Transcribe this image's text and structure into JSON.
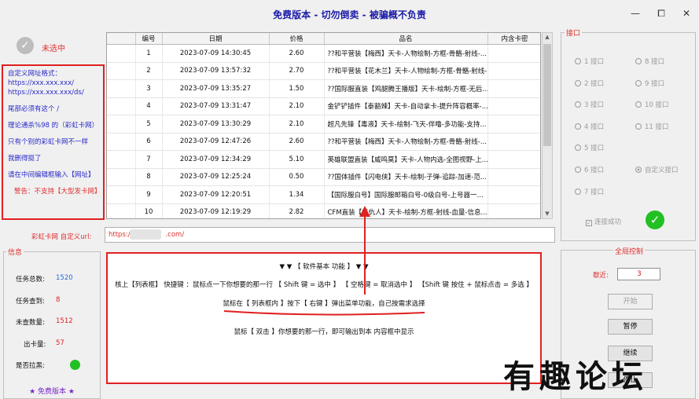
{
  "window": {
    "title": "免费版本 - 切勿倒卖 - 被骗概不负责",
    "min": "—",
    "max": "⧠",
    "close": "✕"
  },
  "status": {
    "unselected": "未选中"
  },
  "note": {
    "lines": [
      "自定义网址格式：",
      "https://xxx.xxx.xxx/",
      "https://xxx.xxx.xxx/ds/",
      "尾部必须有这个 /",
      "理论通杀%98 的（彩虹卡网）",
      "只有个别的彩虹卡网不一样",
      "我删得挺了",
      "请在中间编辑框输入【网址】",
      "警告：不支持【大型发卡网】"
    ]
  },
  "table": {
    "headers": [
      "",
      "编号",
      "日期",
      "价格",
      "品名",
      "内含卡密"
    ],
    "rows": [
      {
        "no": "1",
        "date": "2023-07-09 14:30:45",
        "price": "2.60",
        "name": "??和平营装【梅西】天卡-人物绘制-方框-骨骼-射线-...",
        "card": ""
      },
      {
        "no": "2",
        "date": "2023-07-09 13:57:32",
        "price": "2.70",
        "name": "??和平营装【花木兰】天卡-人物绘制-方框-骨骼-射线-...",
        "card": ""
      },
      {
        "no": "3",
        "date": "2023-07-09 13:35:27",
        "price": "1.50",
        "name": "??国际服直装【鸡腿腾王播版】天卡-绘制-方框-无后...",
        "card": ""
      },
      {
        "no": "4",
        "date": "2023-07-09 13:31:47",
        "price": "2.10",
        "name": "金铲铲插件【泰豁辣】天卡-自动拿卡-提升阵容概率-...",
        "card": ""
      },
      {
        "no": "5",
        "date": "2023-07-09 13:30:29",
        "price": "2.10",
        "name": "超凡先锋【毒液】天卡-绘制-飞天-伴噜-多功能-支持...",
        "card": ""
      },
      {
        "no": "6",
        "date": "2023-07-09 12:47:26",
        "price": "2.60",
        "name": "??和平营装【梅西】天卡-人物绘制-方框-骨骼-射线-...",
        "card": ""
      },
      {
        "no": "7",
        "date": "2023-07-09 12:34:29",
        "price": "5.10",
        "name": "英雄联盟直装【威鸣莫】天卡-人物内选-全图视野-上...",
        "card": ""
      },
      {
        "no": "8",
        "date": "2023-07-09 12:25:24",
        "price": "0.50",
        "name": "??国体插件【闪电侠】天卡-绘制-子弹-追踪-加速-范...",
        "card": ""
      },
      {
        "no": "9",
        "date": "2023-07-09 12:20:51",
        "price": "1.34",
        "name": "【国际服白号】国际服邮箱白号-0级白号-上号器一...",
        "card": ""
      },
      {
        "no": "10",
        "date": "2023-07-09 12:19:29",
        "price": "2.82",
        "name": "CFM直装【复仇人】天卡-绘制-方框-射线-血量-信息...",
        "card": ""
      }
    ]
  },
  "url": {
    "label": "彩虹卡网 自定义url:",
    "value": "https://",
    "suffix": ".com/"
  },
  "info": {
    "title": "信息",
    "total_label": "任务总数:",
    "total": "1520",
    "checked_label": "任务查到:",
    "checked": "8",
    "unchecked_label": "未查数量:",
    "unchecked": "1512",
    "cards_label": "出卡量:",
    "cards": "57",
    "pull_label": "是否拉黑:",
    "free": "★ 免费版本 ★"
  },
  "help": {
    "title": "▼ ▼ 【 软件基本 功能 】 ▼ ▼",
    "line1": "核上【列表框】 快捷键 ：鼠标点一下你想要的那一行 【 Shift 键 = 选中 】     【 空格键 = 取消选中 】     【Shift 键 按住 + 鼠标点击 = 多选 】",
    "line2": "鼠标在【 列表框内 】按下【 右键 】弹出菜单功能，自己按需求选择",
    "line3": "鼠标【 双击 】你想要的那一行，即可输出到本 内容框中显示"
  },
  "interfaces": {
    "title": "接口",
    "left": [
      "1 接口",
      "2 接口",
      "3 接口",
      "4 接口",
      "5 接口",
      "6 接口",
      "7 接口"
    ],
    "right": [
      "8 接口",
      "9 接口",
      "10 接口",
      "11 接口",
      "自定义接口"
    ],
    "connected": "连接成功"
  },
  "global": {
    "title": "全局控制",
    "interval_label": "歇近:",
    "interval": "3",
    "start": "开始",
    "pause": "暂停",
    "resume": "继续",
    "stop": "停止"
  },
  "watermark": "有趣论坛"
}
